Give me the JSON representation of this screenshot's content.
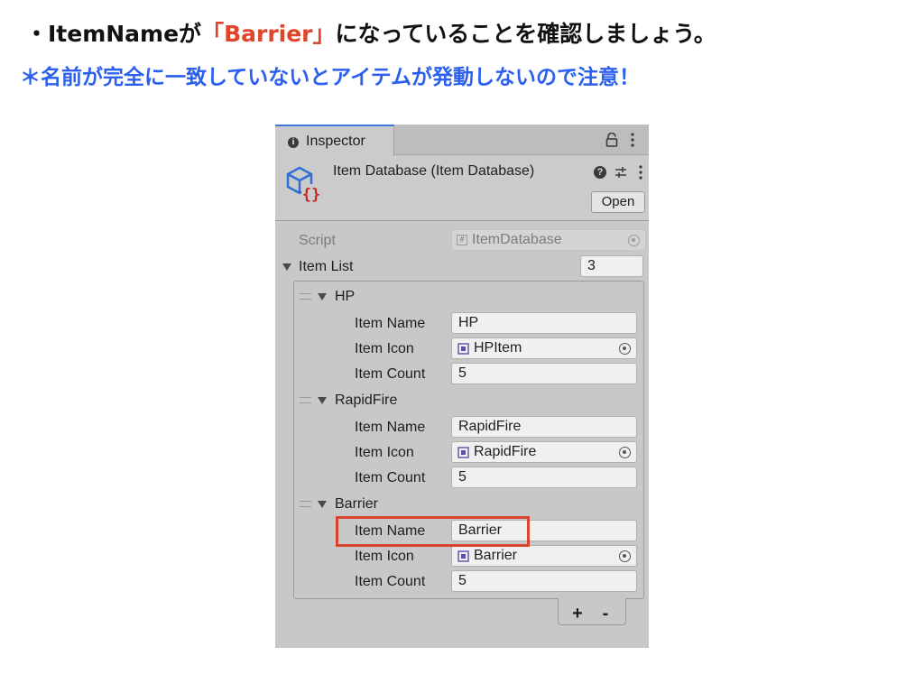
{
  "slide": {
    "line1_pre": "・ItemNameが",
    "line1_highlight": "「Barrier」",
    "line1_post": "になっていることを確認しましょう。",
    "line2": "＊名前が完全に一致していないとアイテムが発動しないので注意！"
  },
  "inspector": {
    "tab_label": "Inspector",
    "asset_title": "Item Database (Item Database)",
    "open_label": "Open",
    "help_glyph": "?",
    "script_label": "Script",
    "script_value": "ItemDatabase",
    "list_label": "Item List",
    "list_count": "3",
    "add_label": "+",
    "remove_label": "-",
    "items": [
      {
        "header": "HP",
        "name_label": "Item Name",
        "name_value": "HP",
        "icon_label": "Item Icon",
        "icon_value": "HPItem",
        "count_label": "Item Count",
        "count_value": "5"
      },
      {
        "header": "RapidFire",
        "name_label": "Item Name",
        "name_value": "RapidFire",
        "icon_label": "Item Icon",
        "icon_value": "RapidFire",
        "count_label": "Item Count",
        "count_value": "5"
      },
      {
        "header": "Barrier",
        "name_label": "Item Name",
        "name_value": "Barrier",
        "icon_label": "Item Icon",
        "icon_value": "Barrier",
        "count_label": "Item Count",
        "count_value": "5"
      }
    ]
  },
  "colors": {
    "highlight_text": "#e0442b",
    "note_text": "#2b5ff0",
    "highlight_box": "#d9442c",
    "tab_accent": "#3a79d8"
  }
}
